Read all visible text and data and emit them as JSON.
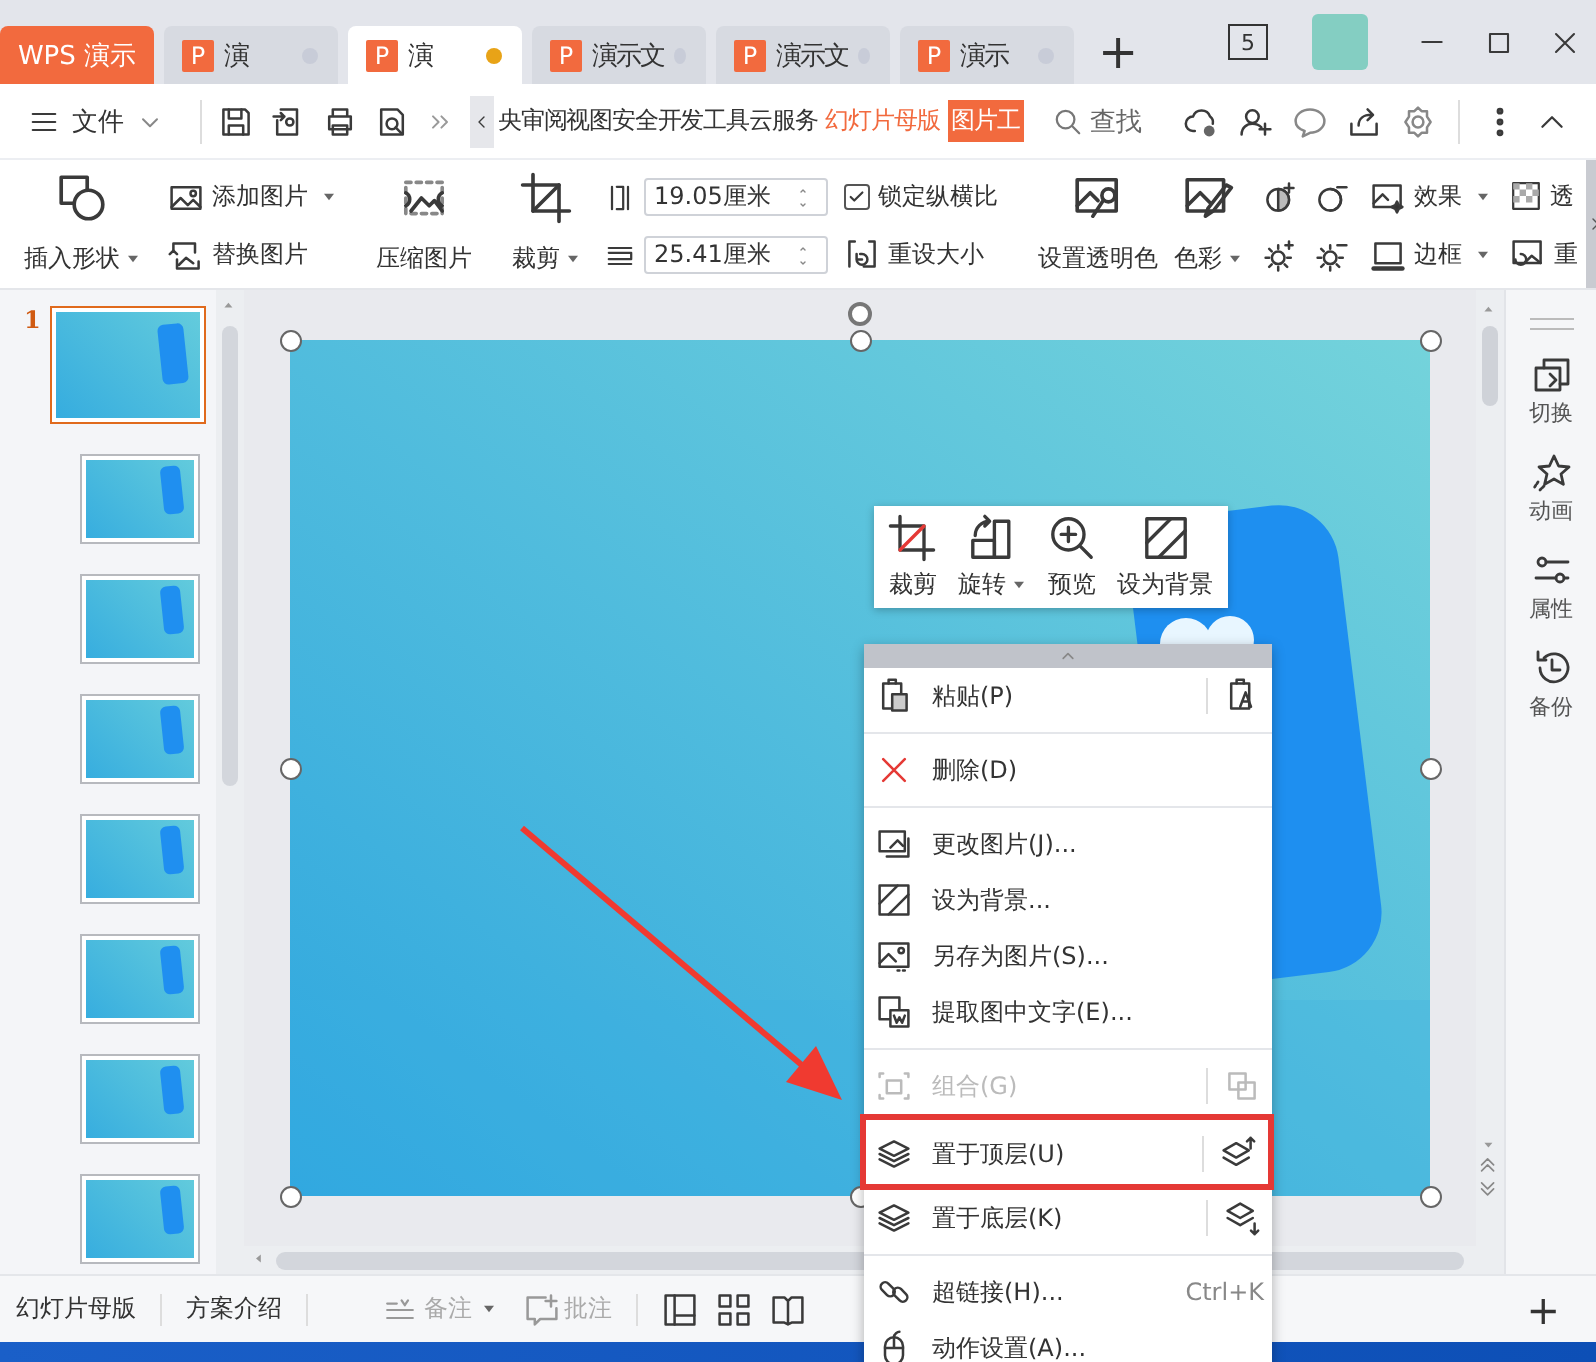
{
  "tabs": [
    {
      "kind": "home",
      "label": "WPS 演示",
      "selected": false
    },
    {
      "kind": "doc",
      "badge": "P",
      "label": "演",
      "selected": false,
      "modified": false
    },
    {
      "kind": "doc",
      "badge": "P",
      "label": "演",
      "selected": true,
      "modified": true
    },
    {
      "kind": "doc",
      "badge": "P",
      "label": "演示文",
      "selected": false,
      "modified": false
    },
    {
      "kind": "doc",
      "badge": "P",
      "label": "演示文",
      "selected": false,
      "modified": false
    },
    {
      "kind": "doc",
      "badge": "P",
      "label": "演示",
      "selected": false,
      "modified": false
    }
  ],
  "new_tab": "+",
  "window_count": "5",
  "menu": {
    "file": "文件",
    "search": "查找",
    "ribbon_tabs": [
      {
        "kind": "standard",
        "label": "央",
        "selected": false
      },
      {
        "kind": "standard",
        "label": "审阅",
        "selected": false
      },
      {
        "kind": "standard",
        "label": "视图",
        "selected": false
      },
      {
        "kind": "standard",
        "label": "安全",
        "selected": false
      },
      {
        "kind": "standard",
        "label": "开发工具",
        "selected": false
      },
      {
        "kind": "standard",
        "label": "云服务",
        "selected": false
      },
      {
        "kind": "contextual",
        "label": "幻灯片母版",
        "selected": false
      },
      {
        "kind": "contextual",
        "label": "图片工",
        "selected": true
      }
    ]
  },
  "ribbon": {
    "insert_shape": "插入形状",
    "add_picture": "添加图片",
    "replace_picture": "替换图片",
    "compress": "压缩图片",
    "crop": "裁剪",
    "height": "19.05厘米",
    "width": "25.41厘米",
    "lock_ratio": {
      "label": "锁定纵横比",
      "checked": true
    },
    "reset_size": "重设大小",
    "set_transparent": "设置透明色",
    "recolor": "色彩",
    "effects": "效果",
    "border": "边框",
    "transparency": "透",
    "reset": "重"
  },
  "thumbnails": [
    {
      "number": "1",
      "selected": true
    },
    {
      "selected": false
    },
    {
      "selected": false
    },
    {
      "selected": false
    },
    {
      "selected": false
    },
    {
      "selected": false
    },
    {
      "selected": false
    },
    {
      "selected": false
    }
  ],
  "mini_toolbar": [
    {
      "label": "裁剪",
      "dropdown": false
    },
    {
      "label": "旋转",
      "dropdown": true
    },
    {
      "label": "预览",
      "dropdown": false
    },
    {
      "label": "设为背景",
      "dropdown": false
    }
  ],
  "context_menu": {
    "groups": [
      [
        {
          "label": "粘贴(P)",
          "disabled": false,
          "highlighted": false
        }
      ],
      [
        {
          "label": "删除(D)",
          "disabled": false,
          "highlighted": false
        }
      ],
      [
        {
          "label": "更改图片(J)...",
          "disabled": false,
          "highlighted": false
        },
        {
          "label": "设为背景...",
          "disabled": false,
          "highlighted": false
        },
        {
          "label": "另存为图片(S)...",
          "disabled": false,
          "highlighted": false
        },
        {
          "label": "提取图中文字(E)...",
          "disabled": false,
          "highlighted": false
        }
      ],
      [
        {
          "label": "组合(G)",
          "disabled": true,
          "highlighted": false
        },
        {
          "label": "置于顶层(U)",
          "disabled": false,
          "highlighted": true
        },
        {
          "label": "置于底层(K)",
          "disabled": false,
          "highlighted": false
        }
      ],
      [
        {
          "label": "超链接(H)...",
          "shortcut": "Ctrl+K",
          "disabled": false,
          "highlighted": false
        },
        {
          "label": "动作设置(A)...",
          "disabled": false,
          "highlighted": false
        }
      ]
    ]
  },
  "side_panel": [
    {
      "label": "切换"
    },
    {
      "label": "动画"
    },
    {
      "label": "属性"
    },
    {
      "label": "备份"
    }
  ],
  "status_bar": {
    "items": [
      {
        "label": "幻灯片母版",
        "disabled": false
      },
      {
        "label": "方案介绍",
        "disabled": false
      }
    ],
    "notes": {
      "label": "备注",
      "disabled": true
    },
    "comments": {
      "label": "批注",
      "disabled": true
    },
    "add": "+"
  }
}
